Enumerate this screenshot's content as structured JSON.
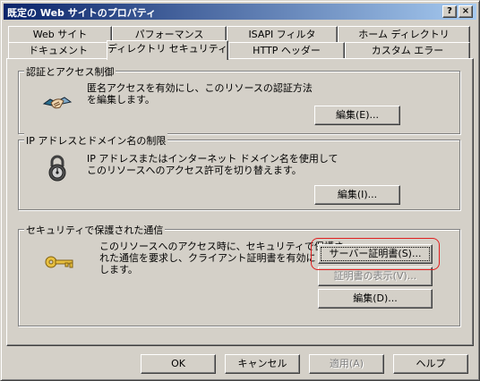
{
  "window": {
    "title": "既定の Web サイトのプロパティ",
    "help_button": "?",
    "close_button": "×"
  },
  "tabs": {
    "back_row": [
      "Web サイト",
      "パフォーマンス",
      "ISAPI フィルタ",
      "ホーム ディレクトリ"
    ],
    "front_row": [
      "ドキュメント",
      "ディレクトリ セキュリティ",
      "HTTP ヘッダー",
      "カスタム エラー"
    ],
    "active": "ディレクトリ セキュリティ"
  },
  "auth_group": {
    "title": "認証とアクセス制御",
    "description": "匿名アクセスを有効にし、このリソースの認証方法\nを編集します。",
    "edit_button": "編集(E)...",
    "icon": "handshake-icon"
  },
  "ip_group": {
    "title": "IP アドレスとドメイン名の制限",
    "description": "IP アドレスまたはインターネット ドメイン名を使用して\nこのリソースへのアクセス許可を切り替えます。",
    "edit_button": "編集(I)...",
    "icon": "lock-icon"
  },
  "secure_group": {
    "title": "セキュリティで保護された通信",
    "description": "このリソースへのアクセス時に、セキュリティで保護さ\nれた通信を要求し、クライアント証明書を有効に\nします。",
    "server_cert_button": "サーバー証明書(S)...",
    "view_cert_button": "証明書の表示(V)...",
    "edit_button": "編集(D)...",
    "icon": "key-icon"
  },
  "footer": {
    "ok": "OK",
    "cancel": "キャンセル",
    "apply": "適用(A)",
    "help": "ヘルプ"
  },
  "colors": {
    "titlebar_start": "#0a246a",
    "titlebar_end": "#a6caf0",
    "highlight": "#e02020",
    "face": "#d4d0c8"
  }
}
